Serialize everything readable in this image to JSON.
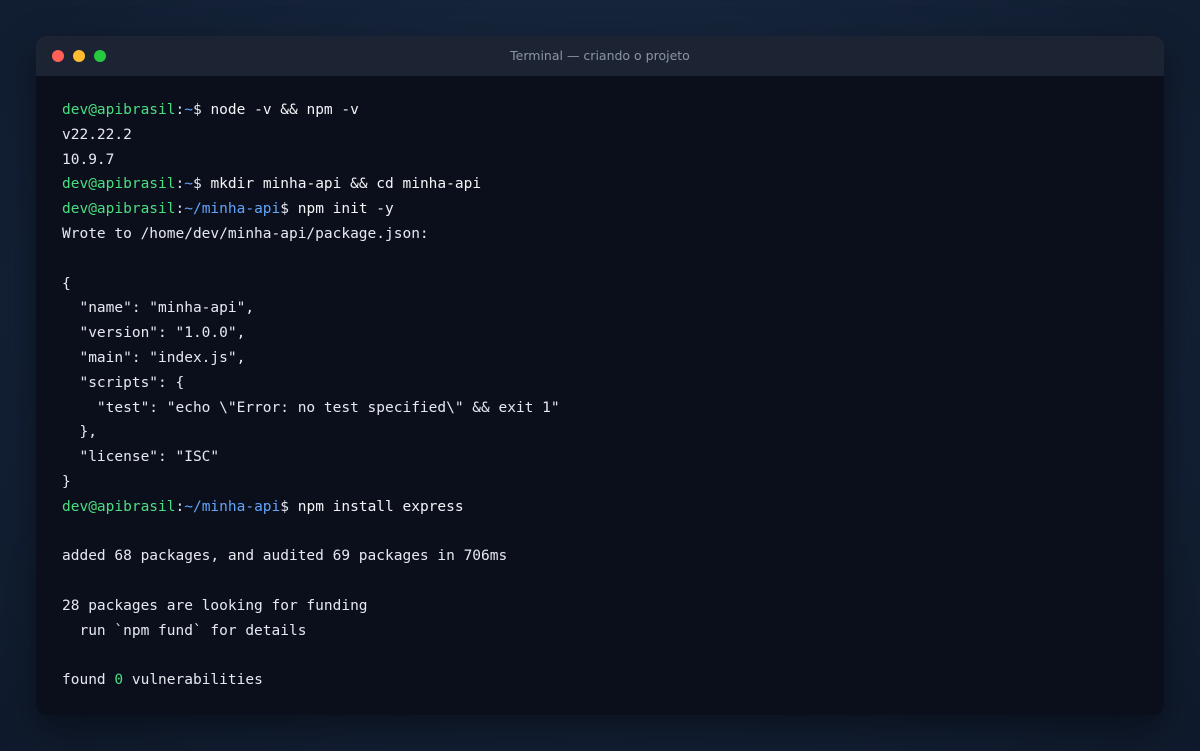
{
  "window": {
    "title": "Terminal — criando o projeto"
  },
  "lines": [
    {
      "type": "prompt",
      "user": "dev@apibrasil",
      "path": "~",
      "sign": "$ ",
      "cmd": "node -v && npm -v"
    },
    {
      "type": "output",
      "text": "v22.22.2"
    },
    {
      "type": "output",
      "text": "10.9.7"
    },
    {
      "type": "prompt",
      "user": "dev@apibrasil",
      "path": "~",
      "sign": "$ ",
      "cmd": "mkdir minha-api && cd minha-api"
    },
    {
      "type": "prompt",
      "user": "dev@apibrasil",
      "path": "~/minha-api",
      "sign": "$ ",
      "cmd": "npm init -y"
    },
    {
      "type": "output",
      "text": "Wrote to /home/dev/minha-api/package.json:"
    },
    {
      "type": "output",
      "text": ""
    },
    {
      "type": "output",
      "text": "{"
    },
    {
      "type": "output",
      "text": "  \"name\": \"minha-api\","
    },
    {
      "type": "output",
      "text": "  \"version\": \"1.0.0\","
    },
    {
      "type": "output",
      "text": "  \"main\": \"index.js\","
    },
    {
      "type": "output",
      "text": "  \"scripts\": {"
    },
    {
      "type": "output",
      "text": "    \"test\": \"echo \\\"Error: no test specified\\\" && exit 1\""
    },
    {
      "type": "output",
      "text": "  },"
    },
    {
      "type": "output",
      "text": "  \"license\": \"ISC\""
    },
    {
      "type": "output",
      "text": "}"
    },
    {
      "type": "prompt",
      "user": "dev@apibrasil",
      "path": "~/minha-api",
      "sign": "$ ",
      "cmd": "npm install express"
    },
    {
      "type": "output",
      "text": ""
    },
    {
      "type": "output",
      "text": "added 68 packages, and audited 69 packages in 706ms"
    },
    {
      "type": "output",
      "text": ""
    },
    {
      "type": "output",
      "text": "28 packages are looking for funding"
    },
    {
      "type": "output",
      "text": "  run `npm fund` for details"
    },
    {
      "type": "output",
      "text": ""
    },
    {
      "type": "highlight",
      "before": "found ",
      "value": "0",
      "after": " vulnerabilities"
    }
  ],
  "colors": {
    "user": "#4ade80",
    "path": "#60a5fa",
    "text": "#e5e8ef",
    "background": "#0b0f1c",
    "titlebar": "#1c2433"
  }
}
